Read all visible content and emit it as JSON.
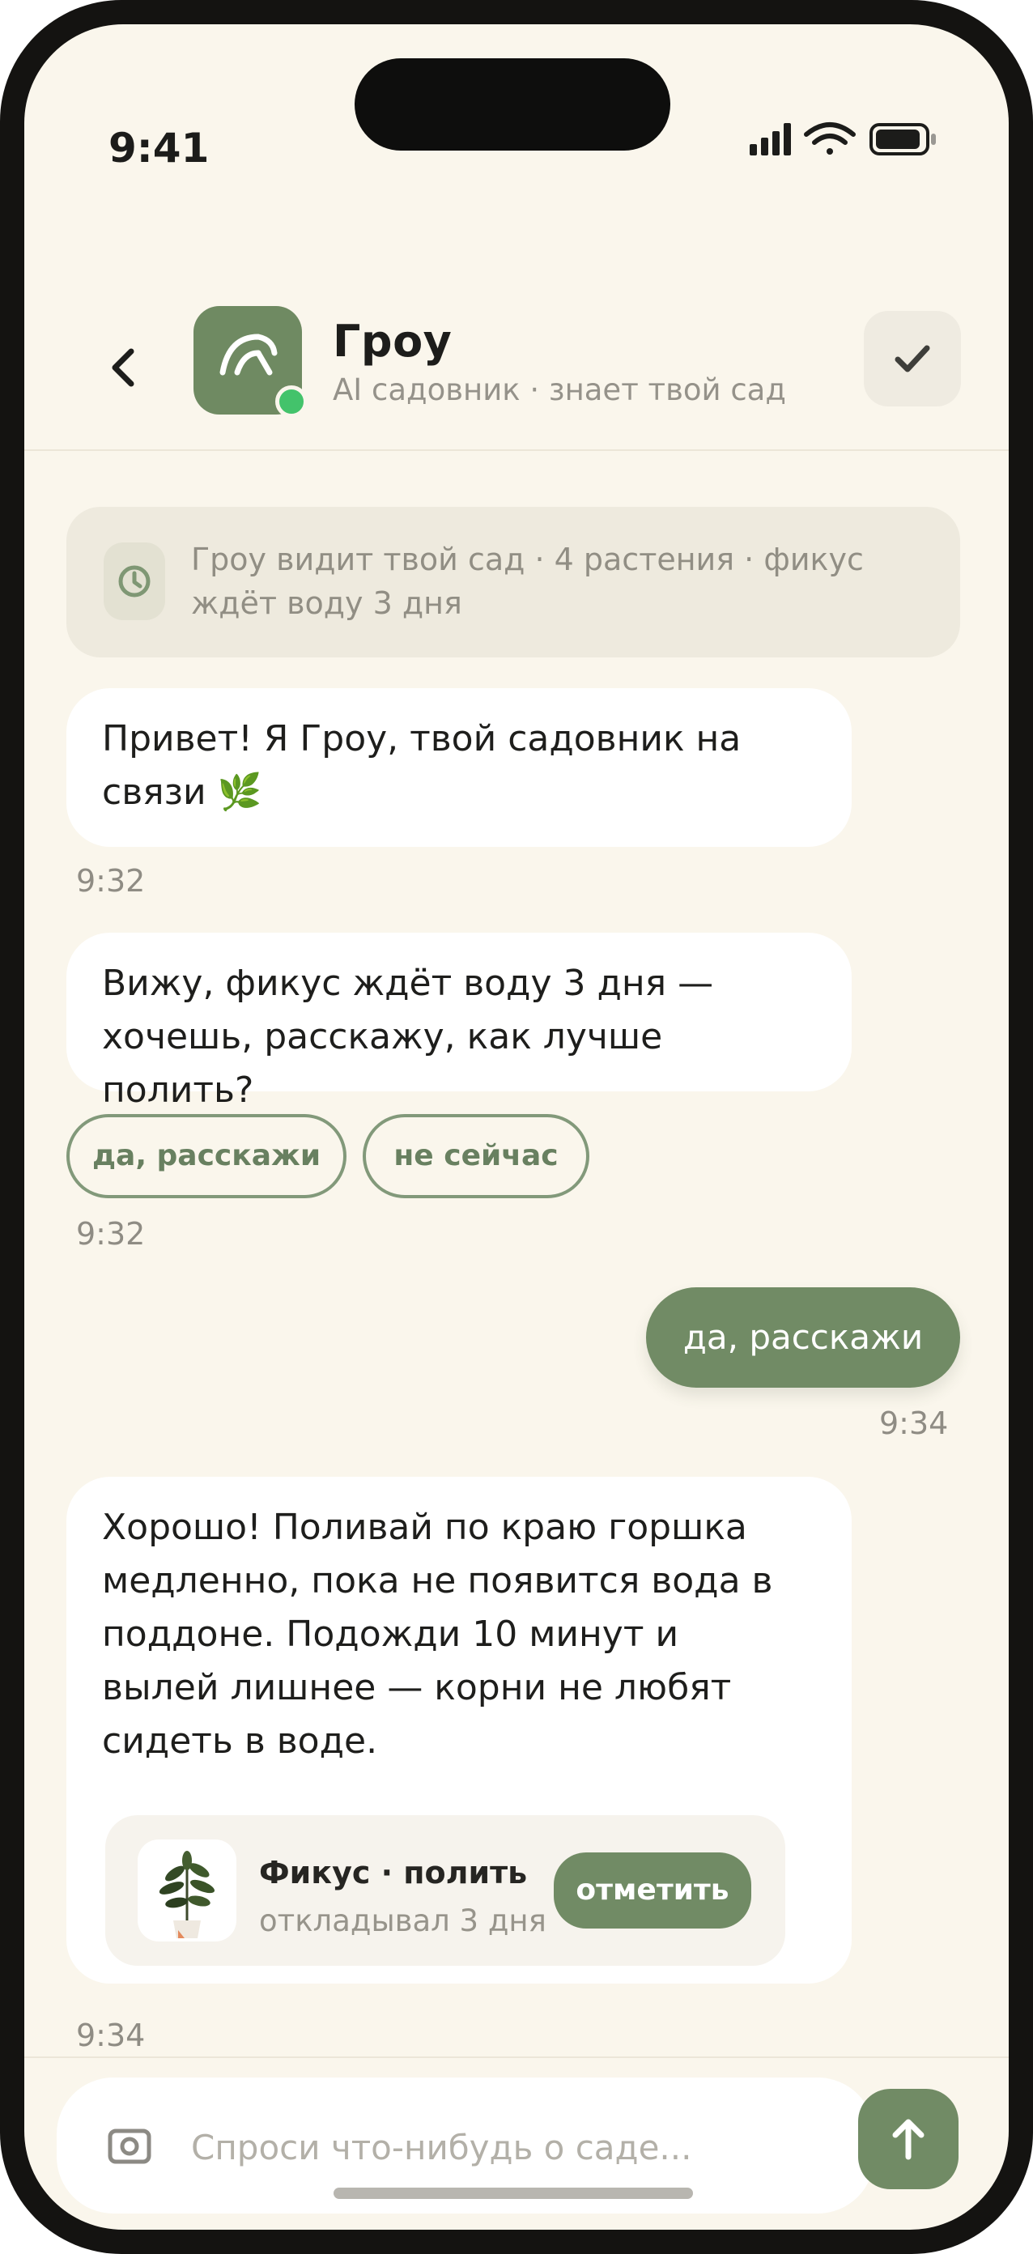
{
  "status_bar": {
    "time": "9:41"
  },
  "header": {
    "name": "Гроу",
    "subtitle": "AI садовник · знает твой сад",
    "avatar_icon": "sprout-arc-icon",
    "online": true
  },
  "context_card": {
    "icon": "clock-icon",
    "text": "Гроу видит твой сад · 4 растения · фикус ждёт воду 3 дня"
  },
  "messages": [
    {
      "from": "bot",
      "text": "Привет! Я Гроу, твой садовник на связи 🌿",
      "time": "9:32"
    },
    {
      "from": "bot",
      "text": "Вижу, фикус ждёт воду 3 дня — хочешь, расскажу, как лучше полить?",
      "time": "9:32",
      "quick_replies": [
        "да, расскажи",
        "не сейчас"
      ]
    },
    {
      "from": "user",
      "text": "да, расскажи",
      "time": "9:34"
    },
    {
      "from": "bot",
      "text": "Хорошо! Поливай по краю горшка медленно, пока не появится вода в поддоне. Подожди 10 минут и вылей лишнее — корни не любят сидеть в воде.",
      "time": "9:34",
      "task_card": {
        "title": "Фикус · полить",
        "subtitle": "откладывал 3 дня",
        "button": "отметить"
      }
    }
  ],
  "composer": {
    "placeholder": "Спроси что-нибудь о саде...",
    "value": ""
  },
  "colors": {
    "accent": "#718b65",
    "background": "#faf6ec",
    "online": "#43c36b"
  }
}
